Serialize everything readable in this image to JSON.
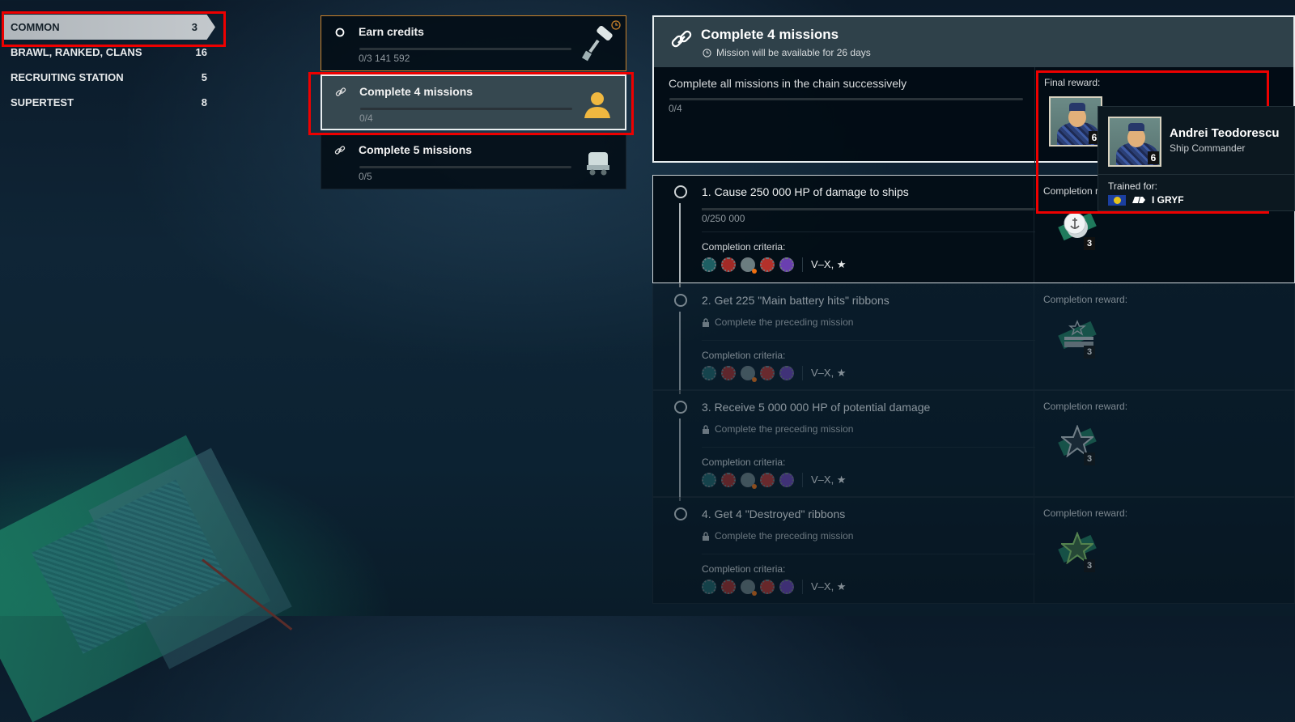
{
  "sidebar": {
    "categories": [
      {
        "label": "COMMON",
        "count": "3",
        "active": true
      },
      {
        "label": "BRAWL, RANKED, CLANS",
        "count": "16"
      },
      {
        "label": "RECRUITING STATION",
        "count": "5"
      },
      {
        "label": "SUPERTEST",
        "count": "8"
      }
    ]
  },
  "missions": [
    {
      "title": "Earn credits",
      "progress": "0/3 141 592",
      "progress_fraction": 0,
      "type": "single",
      "timed": true,
      "reward_icon": "paint-roller-icon"
    },
    {
      "title": "Complete 4 missions",
      "progress": "0/4",
      "progress_fraction": 0,
      "type": "chain",
      "selected": true,
      "reward_icon": "commander-icon"
    },
    {
      "title": "Complete 5 missions",
      "progress": "0/5",
      "progress_fraction": 0,
      "type": "chain",
      "reward_icon": "supply-cart-icon"
    }
  ],
  "detail": {
    "title": "Complete 4 missions",
    "availability": "Mission will be available for 26 days",
    "description": "Complete all missions in the chain successively",
    "progress": "0/4",
    "progress_fraction": 0,
    "final_reward_label": "Final reward:",
    "final_reward_level": "6"
  },
  "tooltip": {
    "name": "Andrei Teodorescu",
    "role": "Ship Commander",
    "level": "6",
    "trained_for_label": "Trained for:",
    "ship": "I GRYF"
  },
  "tasks": [
    {
      "title": "1. Cause 250 000 HP of damage to ships",
      "progress": "0/250 000",
      "locked": false,
      "criteria_label": "Completion criteria:",
      "tiers": "V–X, ★",
      "reward_label": "Completion reward:",
      "reward_count": "3",
      "reward_icon": "anchor-coin-icon"
    },
    {
      "title": "2. Get 225 \"Main battery hits\" ribbons",
      "lock_text": "Complete the preceding mission",
      "locked": true,
      "criteria_label": "Completion criteria:",
      "tiers": "V–X, ★",
      "reward_label": "Completion reward:",
      "reward_count": "3",
      "reward_icon": "rank-insignia-icon"
    },
    {
      "title": "3. Receive 5 000 000 HP of potential damage",
      "lock_text": "Complete the preceding mission",
      "locked": true,
      "criteria_label": "Completion criteria:",
      "tiers": "V–X, ★",
      "reward_label": "Completion reward:",
      "reward_count": "3",
      "reward_icon": "grey-star-icon"
    },
    {
      "title": "4. Get 4 \"Destroyed\" ribbons",
      "lock_text": "Complete the preceding mission",
      "locked": true,
      "criteria_label": "Completion criteria:",
      "tiers": "V–X, ★",
      "reward_label": "Completion reward:",
      "reward_count": "3",
      "reward_icon": "green-star-icon"
    }
  ],
  "criteria_classes": [
    "destroyer-icon",
    "cruiser-icon",
    "aircraft-carrier-icon",
    "battleship-icon",
    "submarine-icon"
  ],
  "colors": {
    "accent_timed": "#c8812a",
    "highlight": "#e00000",
    "commander_icon": "#f0b840"
  }
}
